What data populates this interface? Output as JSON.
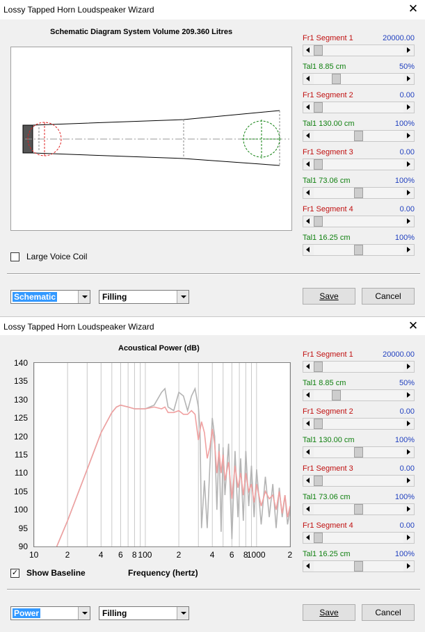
{
  "window1": {
    "title": "Lossy Tapped Horn Loudspeaker Wizard",
    "close_glyph": "✕",
    "diagram_title": "Schematic Diagram   System Volume 209.360 Litres",
    "large_voice_coil_label": "Large Voice Coil",
    "large_voice_coil_checked": false,
    "view_combo": "Schematic",
    "filling_combo": "Filling",
    "save_label": "Save",
    "cancel_label": "Cancel"
  },
  "window2": {
    "title": "Lossy Tapped Horn Loudspeaker Wizard",
    "close_glyph": "✕",
    "plot_title": "Acoustical Power (dB)",
    "xlabel": "Frequency (hertz)",
    "show_baseline_label": "Show Baseline",
    "show_baseline_checked": true,
    "view_combo": "Power",
    "filling_combo": "Filling",
    "save_label": "Save",
    "cancel_label": "Cancel"
  },
  "params": [
    {
      "name": "Fr1  Segment 1",
      "value": "20000.00",
      "kind": "fr",
      "position": 0.0
    },
    {
      "name": "Tal1  8.85 cm",
      "value": "50%",
      "kind": "tal",
      "position": 0.22
    },
    {
      "name": "Fr1  Segment 2",
      "value": "0.00",
      "kind": "fr",
      "position": 0.0
    },
    {
      "name": "Tal1  130.00 cm",
      "value": "100%",
      "kind": "tal",
      "position": 0.5
    },
    {
      "name": "Fr1  Segment 3",
      "value": "0.00",
      "kind": "fr",
      "position": 0.0
    },
    {
      "name": "Tal1  73.06 cm",
      "value": "100%",
      "kind": "tal",
      "position": 0.5
    },
    {
      "name": "Fr1  Segment 4",
      "value": "0.00",
      "kind": "fr",
      "position": 0.0
    },
    {
      "name": "Tal1  16.25 cm",
      "value": "100%",
      "kind": "tal",
      "position": 0.5
    }
  ],
  "colors": {
    "fr_label": "#c01010",
    "tal_label": "#108010",
    "value_text": "#1f3fbf",
    "baseline_curve": "#b4b4b4",
    "response_curve": "#f0a0a0",
    "grid": "#c8c8c8",
    "driver_circle": "#e02020",
    "mouth_circle": "#108010"
  },
  "chart_data": {
    "type": "line",
    "title": "Acoustical Power (dB)",
    "xlabel": "Frequency (hertz)",
    "ylabel": "",
    "xscale": "log",
    "xlim": [
      10,
      2000
    ],
    "ylim": [
      90,
      140
    ],
    "yticks": [
      "140",
      "135",
      "130",
      "125",
      "120",
      "115",
      "110",
      "105",
      "100",
      "95",
      "90"
    ],
    "xtick_labels": [
      "10",
      "2",
      "4",
      "6",
      "8",
      "100",
      "2",
      "4",
      "6",
      "8",
      "1000",
      "2"
    ],
    "xtick_values": [
      10,
      20,
      40,
      60,
      80,
      100,
      200,
      400,
      600,
      800,
      1000,
      2000
    ],
    "grid": true,
    "series": [
      {
        "name": "",
        "color": "#b4b4b4",
        "x": [
          16,
          20,
          30,
          40,
          50,
          55,
          60,
          70,
          80,
          100,
          120,
          140,
          150,
          160,
          180,
          200,
          220,
          240,
          260,
          280,
          300,
          310,
          320,
          340,
          360,
          380,
          400,
          420,
          440,
          460,
          480,
          500,
          520,
          560,
          600,
          640,
          680,
          720,
          760,
          800,
          850,
          900,
          950,
          1000,
          1100,
          1200,
          1300,
          1400,
          1500,
          1600,
          1700,
          1800,
          1900,
          2000
        ],
        "y": [
          90,
          97,
          111,
          121,
          126.5,
          128,
          128.5,
          128,
          127.5,
          127.5,
          128.5,
          132,
          133,
          128,
          127,
          132,
          131,
          127,
          131,
          133,
          128,
          122,
          95,
          108,
          95,
          112,
          125,
          120,
          100,
          118,
          94,
          117,
          104,
          118,
          92,
          116,
          98,
          114,
          97,
          116,
          101,
          112,
          98,
          111,
          96,
          109,
          98,
          107,
          95,
          106,
          98,
          104,
          96,
          100
        ]
      },
      {
        "name": "",
        "color": "#f0a0a0",
        "x": [
          16,
          20,
          30,
          40,
          50,
          55,
          60,
          70,
          80,
          100,
          120,
          140,
          150,
          160,
          180,
          200,
          220,
          240,
          260,
          280,
          300,
          320,
          340,
          360,
          380,
          400,
          420,
          440,
          460,
          480,
          500,
          520,
          560,
          600,
          640,
          680,
          720,
          760,
          800,
          850,
          900,
          950,
          1000,
          1100,
          1200,
          1300,
          1400,
          1500,
          1600,
          1700,
          1800,
          1900,
          2000
        ],
        "y": [
          90,
          97,
          111,
          121,
          126.5,
          128,
          128.5,
          128,
          127.5,
          127.5,
          128,
          127.5,
          128,
          126.5,
          126.5,
          127,
          126,
          126,
          127,
          126,
          119,
          124,
          121,
          114,
          117,
          122,
          118,
          110,
          116,
          110,
          115,
          108,
          113,
          103,
          112,
          106,
          110,
          104,
          110,
          105,
          107,
          102,
          107,
          101,
          105,
          103,
          104,
          100,
          105,
          99,
          104,
          98,
          101
        ]
      }
    ]
  }
}
